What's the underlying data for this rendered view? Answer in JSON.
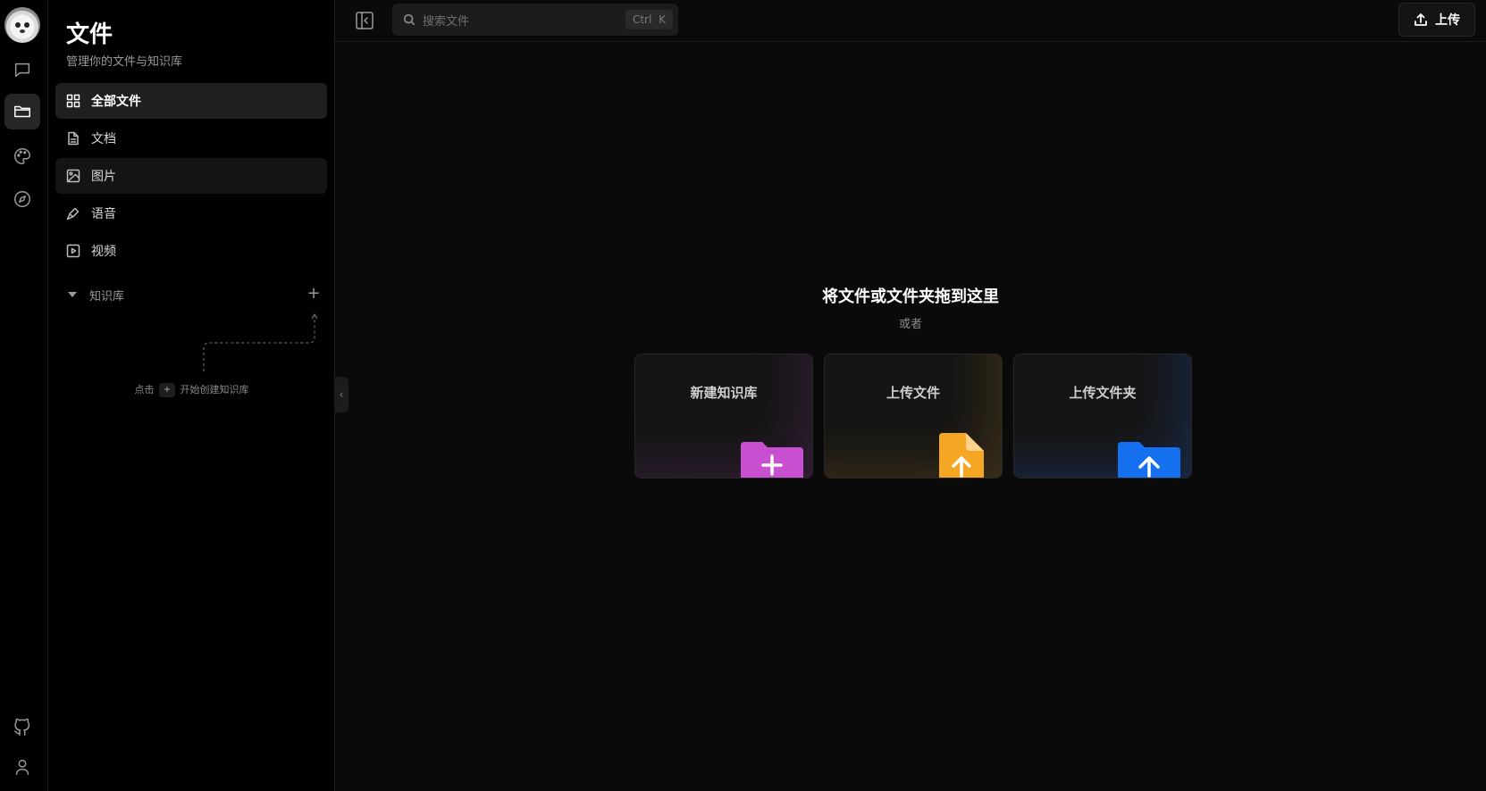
{
  "rail": {
    "items": [
      {
        "name": "chat-icon",
        "active": false
      },
      {
        "name": "folder-icon",
        "active": true
      },
      {
        "name": "palette-icon",
        "active": false
      },
      {
        "name": "compass-icon",
        "active": false
      }
    ],
    "bottom": [
      {
        "name": "github-icon"
      },
      {
        "name": "user-icon"
      }
    ]
  },
  "sidebar": {
    "title": "文件",
    "subtitle": "管理你的文件与知识库",
    "items": [
      {
        "label": "全部文件",
        "icon": "grid-icon",
        "active": true
      },
      {
        "label": "文档",
        "icon": "document-icon",
        "active": false
      },
      {
        "label": "图片",
        "icon": "image-icon",
        "active": false
      },
      {
        "label": "语音",
        "icon": "microphone-icon",
        "active": false
      },
      {
        "label": "视频",
        "icon": "video-icon",
        "active": false
      }
    ],
    "knowledge_base": {
      "label": "知识库",
      "add_symbol": "+",
      "hint_prefix": "点击",
      "hint_chip": "+",
      "hint_suffix": "开始创建知识库"
    }
  },
  "topbar": {
    "search_placeholder": "搜索文件",
    "search_shortcut": "Ctrl K",
    "upload_label": "上传"
  },
  "dropzone": {
    "title": "将文件或文件夹拖到这里",
    "or": "或者",
    "cards": [
      {
        "label": "新建知识库",
        "color": "#c84fd0",
        "icon": "folder-plus-icon"
      },
      {
        "label": "上传文件",
        "color": "#f5a623",
        "icon": "file-upload-icon"
      },
      {
        "label": "上传文件夹",
        "color": "#1570ef",
        "icon": "folder-upload-icon"
      }
    ]
  },
  "colors": {
    "background": "#0a0a0a",
    "sidebar": "#000000",
    "active_item": "#1f1f1f"
  }
}
